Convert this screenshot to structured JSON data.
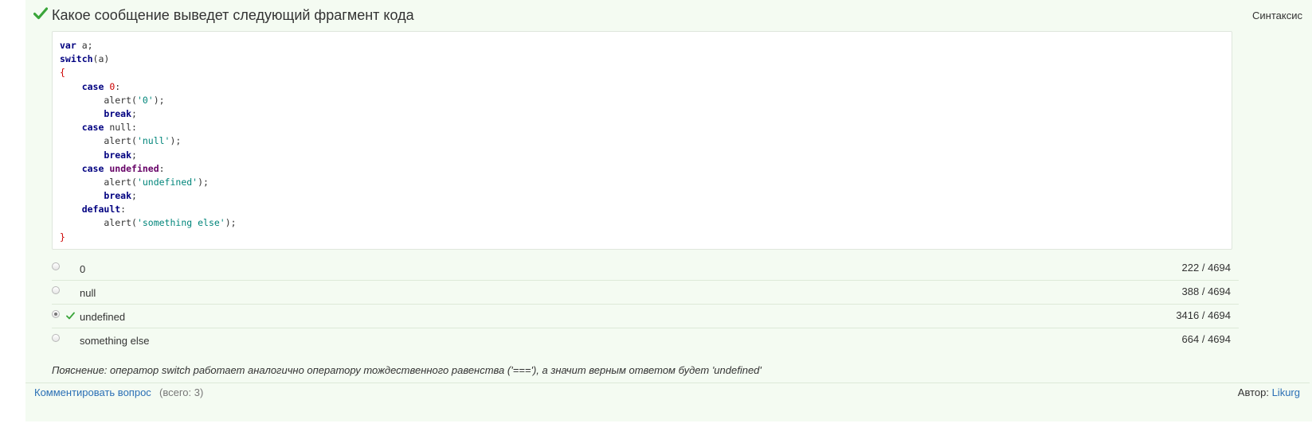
{
  "question": {
    "title": "Какое сообщение выведет следующий фрагмент кода",
    "category": "Синтаксис",
    "status_icon": "check-icon",
    "accent_color": "#3aa53a",
    "code_lines": [
      [
        {
          "t": "kw",
          "v": "var"
        },
        {
          "t": "plain",
          "v": " a;"
        }
      ],
      [
        {
          "t": "kw",
          "v": "switch"
        },
        {
          "t": "plain",
          "v": "(a)"
        }
      ],
      [
        {
          "t": "brace",
          "v": "{"
        }
      ],
      [
        {
          "t": "plain",
          "v": "    "
        },
        {
          "t": "kw",
          "v": "case"
        },
        {
          "t": "plain",
          "v": " "
        },
        {
          "t": "num",
          "v": "0"
        },
        {
          "t": "plain",
          "v": ":"
        }
      ],
      [
        {
          "t": "plain",
          "v": "        alert("
        },
        {
          "t": "str",
          "v": "'0'"
        },
        {
          "t": "plain",
          "v": ");"
        }
      ],
      [
        {
          "t": "plain",
          "v": "        "
        },
        {
          "t": "kw",
          "v": "break"
        },
        {
          "t": "plain",
          "v": ";"
        }
      ],
      [
        {
          "t": "plain",
          "v": "    "
        },
        {
          "t": "kw",
          "v": "case"
        },
        {
          "t": "plain",
          "v": " null:"
        }
      ],
      [
        {
          "t": "plain",
          "v": "        alert("
        },
        {
          "t": "str",
          "v": "'null'"
        },
        {
          "t": "plain",
          "v": ");"
        }
      ],
      [
        {
          "t": "plain",
          "v": "        "
        },
        {
          "t": "kw",
          "v": "break"
        },
        {
          "t": "plain",
          "v": ";"
        }
      ],
      [
        {
          "t": "plain",
          "v": "    "
        },
        {
          "t": "kw",
          "v": "case"
        },
        {
          "t": "plain",
          "v": " "
        },
        {
          "t": "undef",
          "v": "undefined"
        },
        {
          "t": "plain",
          "v": ":"
        }
      ],
      [
        {
          "t": "plain",
          "v": "        alert("
        },
        {
          "t": "str",
          "v": "'undefined'"
        },
        {
          "t": "plain",
          "v": ");"
        }
      ],
      [
        {
          "t": "plain",
          "v": "        "
        },
        {
          "t": "kw",
          "v": "break"
        },
        {
          "t": "plain",
          "v": ";"
        }
      ],
      [
        {
          "t": "plain",
          "v": "    "
        },
        {
          "t": "kw",
          "v": "default"
        },
        {
          "t": "plain",
          "v": ":"
        }
      ],
      [
        {
          "t": "plain",
          "v": "        alert("
        },
        {
          "t": "str",
          "v": "'something else'"
        },
        {
          "t": "plain",
          "v": ");"
        }
      ],
      [
        {
          "t": "brace",
          "v": "}"
        }
      ]
    ]
  },
  "answers": [
    {
      "label": "0",
      "stats": "222 / 4694",
      "selected": false,
      "correct": false
    },
    {
      "label": "null",
      "stats": "388 / 4694",
      "selected": false,
      "correct": false
    },
    {
      "label": "undefined",
      "stats": "3416 / 4694",
      "selected": true,
      "correct": true
    },
    {
      "label": "something else",
      "stats": "664 / 4694",
      "selected": false,
      "correct": false
    }
  ],
  "explanation": "Пояснение: оператор switch работает аналогично оператору тождественного равенства ('==='), а значит верным ответом будет 'undefined'",
  "footer": {
    "comment_link": "Комментировать вопрос",
    "comment_count": "(всего: 3)",
    "author_label": "Автор:",
    "author_name": "Likurg"
  }
}
